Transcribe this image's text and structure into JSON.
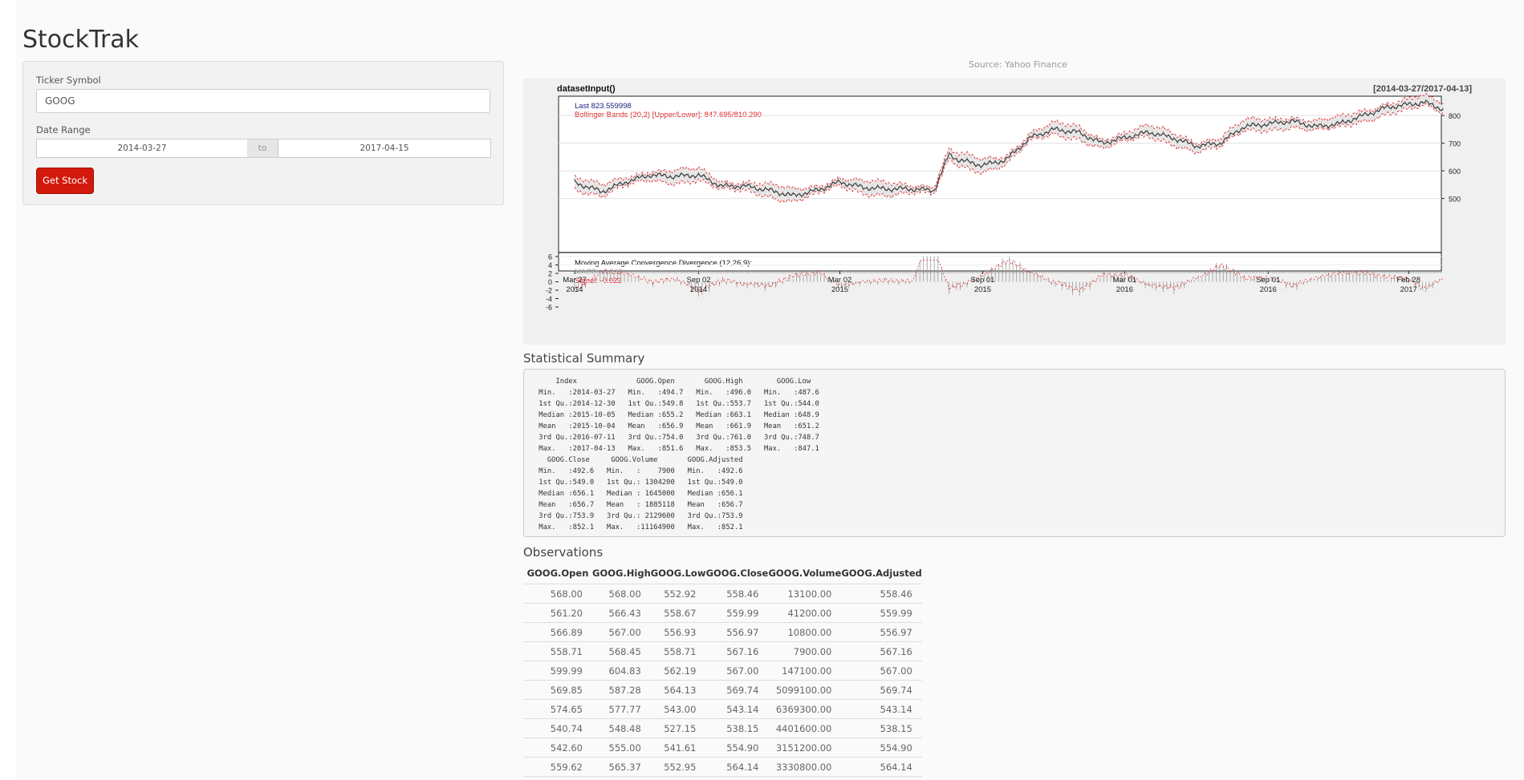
{
  "app": {
    "title": "StockTrak"
  },
  "form": {
    "ticker_label": "Ticker Symbol",
    "ticker_value": "GOOG",
    "date_label": "Date Range",
    "date_start": "2014-03-27",
    "date_separator": "to",
    "date_end": "2017-04-15",
    "button_label": "Get Stock",
    "button_color": "#d2190b"
  },
  "chart": {
    "source": "Source: Yahoo Finance",
    "title": "datasetInput()",
    "range": "[2014-03-27/2017-04-13]",
    "last_label": "Last 823.559998",
    "bbands_label": "Bollinger Bands (20,2) [Upper/Lower]: 847.695/810.290",
    "macd_title": "Moving Average Convergence Divergence (12,26,9):",
    "macd_label": "MACD: -0.182",
    "signal_label": "Signal: -0.022",
    "price_ticks": [
      "800",
      "700",
      "600",
      "500"
    ],
    "macd_ticks": [
      "6",
      "4",
      "2",
      "0",
      "-2",
      "-4",
      "-6"
    ],
    "x_ticks": [
      {
        "month": "Mar 27",
        "year": "2014"
      },
      {
        "month": "Sep 02",
        "year": "2014"
      },
      {
        "month": "Mar 02",
        "year": "2015"
      },
      {
        "month": "Sep 01",
        "year": "2015"
      },
      {
        "month": "Mar 01",
        "year": "2016"
      },
      {
        "month": "Sep 01",
        "year": "2016"
      },
      {
        "month": "Feb 28",
        "year": "2017"
      }
    ],
    "colors": {
      "price": "#222222",
      "bands": "#e41a1c",
      "macd": "#999999",
      "last": "#1a237e"
    }
  },
  "chart_data": {
    "type": "line",
    "title": "datasetInput()",
    "x": [
      "2014-03-27",
      "2014-05-01",
      "2014-06-01",
      "2014-07-01",
      "2014-08-01",
      "2014-09-02",
      "2014-10-01",
      "2014-11-01",
      "2014-12-01",
      "2015-01-01",
      "2015-02-01",
      "2015-03-02",
      "2015-04-01",
      "2015-05-01",
      "2015-06-01",
      "2015-07-01",
      "2015-07-20",
      "2015-08-01",
      "2015-09-01",
      "2015-10-01",
      "2015-11-01",
      "2015-12-01",
      "2016-01-01",
      "2016-02-01",
      "2016-03-01",
      "2016-04-01",
      "2016-05-01",
      "2016-06-01",
      "2016-07-01",
      "2016-08-01",
      "2016-09-01",
      "2016-10-01",
      "2016-11-01",
      "2016-12-01",
      "2017-01-01",
      "2017-02-01",
      "2017-02-28",
      "2017-03-20",
      "2017-04-13"
    ],
    "series": [
      {
        "values": [
          558,
          525,
          560,
          585,
          580,
          585,
          545,
          545,
          530,
          510,
          530,
          560,
          540,
          535,
          535,
          530,
          660,
          640,
          620,
          640,
          720,
          750,
          740,
          700,
          720,
          740,
          720,
          690,
          700,
          760,
          770,
          780,
          760,
          770,
          800,
          830,
          840,
          848,
          824
        ]
      }
    ],
    "ylim": [
      470,
      870
    ]
  },
  "summary": {
    "heading": "Statistical Summary",
    "text": "     Index              GOOG.Open       GOOG.High        GOOG.Low    \n Min.   :2014-03-27   Min.   :494.7   Min.   :496.0   Min.   :487.6  \n 1st Qu.:2014-12-30   1st Qu.:549.8   1st Qu.:553.7   1st Qu.:544.0  \n Median :2015-10-05   Median :655.2   Median :663.1   Median :648.9  \n Mean   :2015-10-04   Mean   :656.9   Mean   :661.9   Mean   :651.2  \n 3rd Qu.:2016-07-11   3rd Qu.:754.0   3rd Qu.:761.0   3rd Qu.:748.7  \n Max.   :2017-04-13   Max.   :851.6   Max.   :853.5   Max.   :847.1  \n   GOOG.Close     GOOG.Volume       GOOG.Adjusted  \n Min.   :492.6   Min.   :    7900   Min.   :492.6  \n 1st Qu.:549.0   1st Qu.: 1304200   1st Qu.:549.0  \n Median :656.1   Median : 1645000   Median :656.1  \n Mean   :656.7   Mean   : 1885118   Mean   :656.7  \n 3rd Qu.:753.9   3rd Qu.: 2129600   3rd Qu.:753.9  \n Max.   :852.1   Max.   :11164900   Max.   :852.1  "
  },
  "observations": {
    "heading": "Observations",
    "columns": [
      "GOOG.Open",
      "GOOG.High",
      "GOOG.Low",
      "GOOG.Close",
      "GOOG.Volume",
      "GOOG.Adjusted"
    ],
    "rows": [
      [
        "568.00",
        "568.00",
        "552.92",
        "558.46",
        "13100.00",
        "558.46"
      ],
      [
        "561.20",
        "566.43",
        "558.67",
        "559.99",
        "41200.00",
        "559.99"
      ],
      [
        "566.89",
        "567.00",
        "556.93",
        "556.97",
        "10800.00",
        "556.97"
      ],
      [
        "558.71",
        "568.45",
        "558.71",
        "567.16",
        "7900.00",
        "567.16"
      ],
      [
        "599.99",
        "604.83",
        "562.19",
        "567.00",
        "147100.00",
        "567.00"
      ],
      [
        "569.85",
        "587.28",
        "564.13",
        "569.74",
        "5099100.00",
        "569.74"
      ],
      [
        "574.65",
        "577.77",
        "543.00",
        "543.14",
        "6369300.00",
        "543.14"
      ],
      [
        "540.74",
        "548.48",
        "527.15",
        "538.15",
        "4401600.00",
        "538.15"
      ],
      [
        "542.60",
        "555.00",
        "541.61",
        "554.90",
        "3151200.00",
        "554.90"
      ],
      [
        "559.62",
        "565.37",
        "552.95",
        "564.14",
        "3330800.00",
        "564.14"
      ]
    ]
  }
}
